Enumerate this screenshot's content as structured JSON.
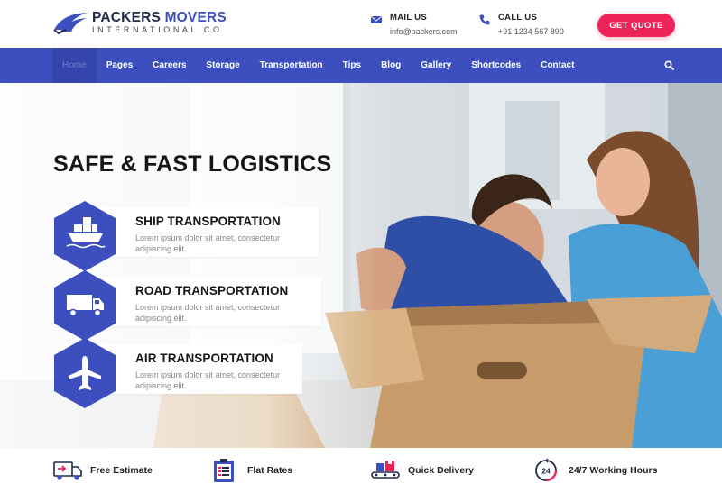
{
  "brand": {
    "name_part1": "PACKERS",
    "name_part2": "MOVERS",
    "tagline": "INTERNATIONAL CO",
    "primary_color": "#3d4fbf",
    "accent_color": "#ec2457"
  },
  "header": {
    "mail": {
      "icon": "envelope-icon",
      "title": "MAIL US",
      "value": "info@packers.com"
    },
    "call": {
      "icon": "phone-icon",
      "title": "CALL US",
      "value": "+91 1234 567 890"
    },
    "quote_button": "GET QUOTE"
  },
  "nav": {
    "items": [
      {
        "label": "Home",
        "active": true
      },
      {
        "label": "Pages"
      },
      {
        "label": "Careers"
      },
      {
        "label": "Storage"
      },
      {
        "label": "Transportation"
      },
      {
        "label": "Tips"
      },
      {
        "label": "Blog"
      },
      {
        "label": "Gallery"
      },
      {
        "label": "Shortcodes"
      },
      {
        "label": "Contact"
      }
    ],
    "search_icon": "search-icon"
  },
  "hero": {
    "title": "SAFE & FAST LOGISTICS",
    "services": [
      {
        "icon": "ship-icon",
        "title": "SHIP TRANSPORTATION",
        "desc_line1": "Lorem ipsum dolor sit amet, consectetur",
        "desc_line2": "adipiscing elit."
      },
      {
        "icon": "truck-icon",
        "title": "ROAD TRANSPORTATION",
        "desc_line1": "Lorem ipsum dolor sit amet, consectetur",
        "desc_line2": "adipiscing elit."
      },
      {
        "icon": "airplane-icon",
        "title": "AIR TRANSPORTATION",
        "desc_line1": "Lorem ipsum dolor sit amet, consectetur",
        "desc_line2": "adipiscing elit."
      }
    ]
  },
  "features": [
    {
      "icon": "delivery-truck-icon",
      "label": "Free Estimate"
    },
    {
      "icon": "clipboard-icon",
      "label": "Flat Rates"
    },
    {
      "icon": "conveyor-boxes-icon",
      "label": "Quick Delivery"
    },
    {
      "icon": "clock-24-icon",
      "label": "24/7 Working Hours"
    }
  ]
}
